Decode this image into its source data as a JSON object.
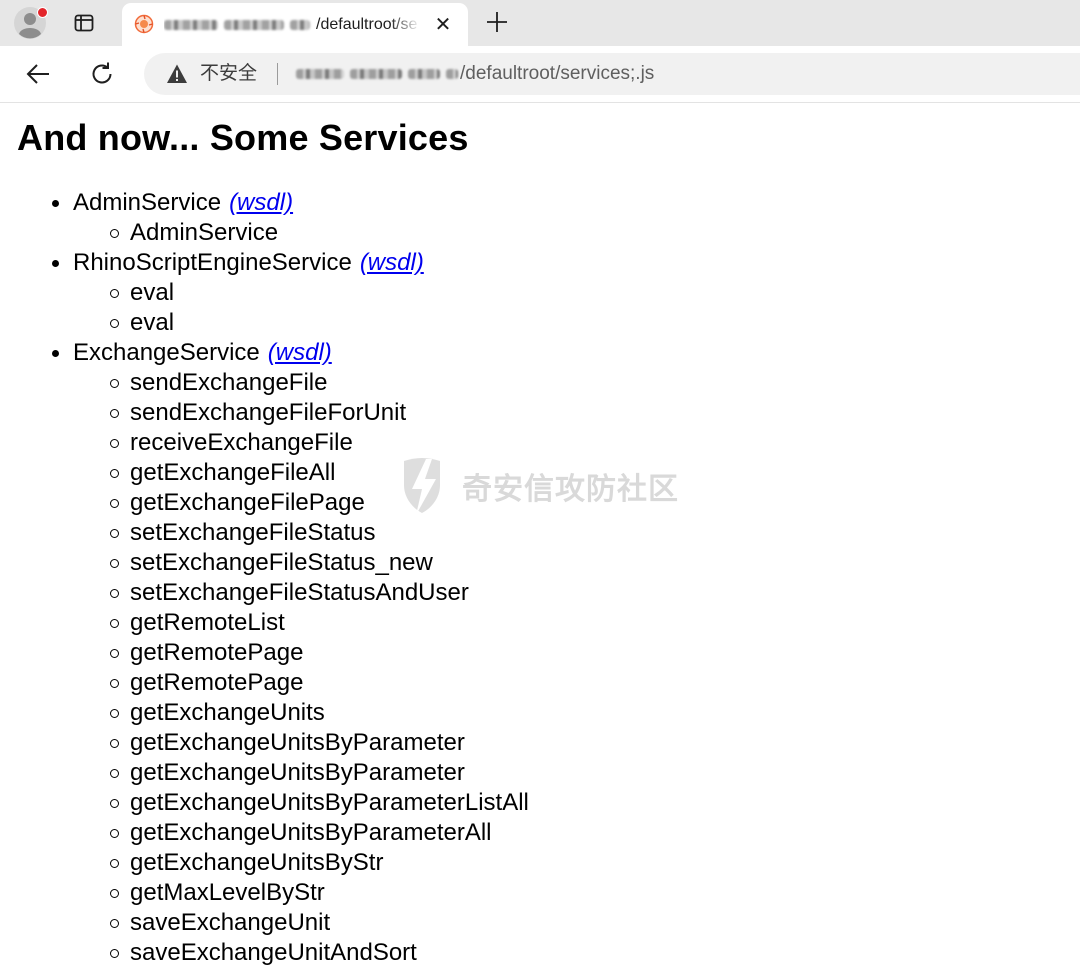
{
  "browser": {
    "tab": {
      "title_suffix": "/defaultroot/se",
      "close_glyph": "✕"
    },
    "new_tab_glyph": "+",
    "omnibox": {
      "security_label": "不安全",
      "url_suffix": "/defaultroot/services;.js"
    },
    "colors": {
      "profile_badge": "#e3252b",
      "link": "#0000ee"
    },
    "icons": {
      "profile": "profile-avatar-icon",
      "tab_actions": "tab-actions-icon",
      "favicon": "site-favicon-icon",
      "close": "close-icon",
      "new_tab": "plus-icon",
      "back": "back-arrow-icon",
      "reload": "reload-icon",
      "warning": "warning-triangle-icon"
    }
  },
  "page": {
    "title": "And now... Some Services",
    "services": [
      {
        "name": "AdminService",
        "wsdl_label": "(wsdl)",
        "operations": [
          "AdminService"
        ]
      },
      {
        "name": "RhinoScriptEngineService",
        "wsdl_label": "(wsdl)",
        "operations": [
          "eval",
          "eval"
        ]
      },
      {
        "name": "ExchangeService",
        "wsdl_label": "(wsdl)",
        "operations": [
          "sendExchangeFile",
          "sendExchangeFileForUnit",
          "receiveExchangeFile",
          "getExchangeFileAll",
          "getExchangeFilePage",
          "setExchangeFileStatus",
          "setExchangeFileStatus_new",
          "setExchangeFileStatusAndUser",
          "getRemoteList",
          "getRemotePage",
          "getRemotePage",
          "getExchangeUnits",
          "getExchangeUnitsByParameter",
          "getExchangeUnitsByParameter",
          "getExchangeUnitsByParameterListAll",
          "getExchangeUnitsByParameterAll",
          "getExchangeUnitsByStr",
          "getMaxLevelByStr",
          "saveExchangeUnit",
          "saveExchangeUnitAndSort"
        ]
      }
    ],
    "watermark": "奇安信攻防社区"
  }
}
